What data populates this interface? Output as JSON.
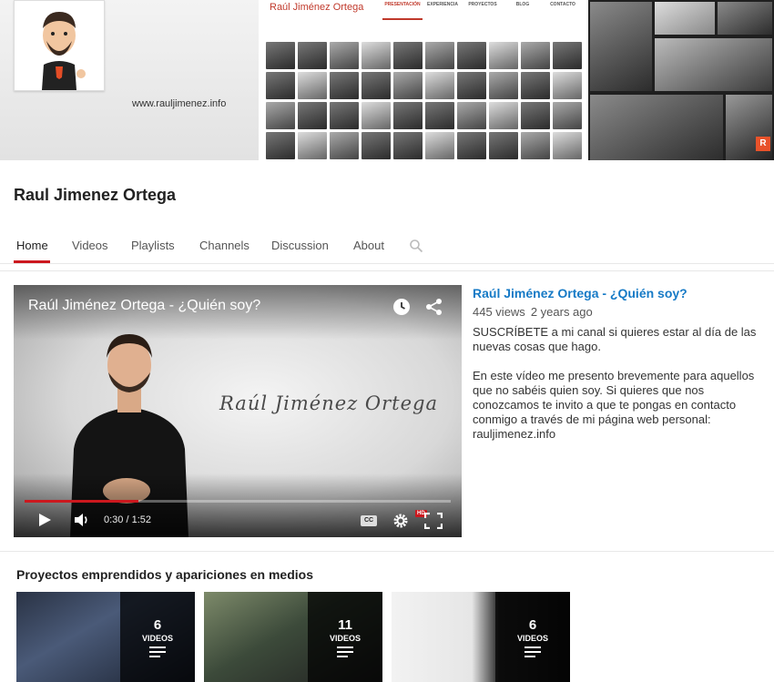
{
  "banner": {
    "url_text": "www.rauljimenez.info",
    "site_title": "Raúl Jiménez Ortega",
    "site_nav": [
      "PRESENTACIÓN",
      "EXPERIENCIA",
      "PROYECTOS",
      "BLOG",
      "CONTACTO"
    ],
    "site_nav_active": "PRESENTACIÓN",
    "badge": "R"
  },
  "channel": {
    "name": "Raul Jimenez Ortega"
  },
  "tabs": [
    {
      "label": "Home",
      "active": true
    },
    {
      "label": "Videos",
      "active": false
    },
    {
      "label": "Playlists",
      "active": false
    },
    {
      "label": "Channels",
      "active": false
    },
    {
      "label": "Discussion",
      "active": false
    },
    {
      "label": "About",
      "active": false
    }
  ],
  "player": {
    "title": "Raúl Jiménez Ortega - ¿Quién soy?",
    "overlay_signature": "Raúl Jiménez Ortega",
    "time_display": "0:30 / 1:52",
    "progress_fraction": 0.267,
    "cc_label": "CC",
    "hd_label": "HD"
  },
  "featured": {
    "title": "Raúl Jiménez Ortega - ¿Quién soy?",
    "views": "445 views",
    "age": "2 years ago",
    "description": "SUSCRÍBETE a mi canal si quieres estar al día de las nuevas cosas que hago.\n\nEn este vídeo me presento brevemente para aquellos que no sabéis quien soy. Si quieres que nos conozcamos te invito a que te pongas en contacto conmigo a través de mi página web personal: rauljimenez.info"
  },
  "section": {
    "title": "Proyectos emprendidos y apariciones en medios",
    "playlists": [
      {
        "count": "6",
        "label": "VIDEOS"
      },
      {
        "count": "11",
        "label": "VIDEOS"
      },
      {
        "count": "6",
        "label": "VIDEOS"
      }
    ]
  },
  "colors": {
    "accent_red": "#cc181e",
    "link_blue": "#167ac6"
  }
}
